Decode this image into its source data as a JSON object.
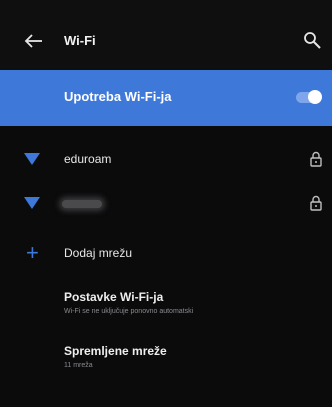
{
  "header": {
    "title": "Wi-Fi",
    "back_icon": "arrow-left-icon",
    "search_icon": "search-icon"
  },
  "wifi_toggle": {
    "label": "Upotreba Wi-Fi-ja",
    "enabled": true
  },
  "networks": [
    {
      "name": "eduroam",
      "secured": true,
      "signal": "full",
      "name_obscured": false
    },
    {
      "name": "",
      "secured": true,
      "signal": "full",
      "name_obscured": true
    }
  ],
  "add_network": {
    "label": "Dodaj mrežu",
    "icon": "plus-icon"
  },
  "settings": {
    "title": "Postavke Wi-Fi-ja",
    "subtitle": "Wi-Fi se ne uključuje ponovno automatski"
  },
  "saved": {
    "title": "Spremljene mreže",
    "subtitle": "11 mreža"
  },
  "colors": {
    "accent": "#3e78d8",
    "background": "#0b0b0c",
    "text_primary": "#ffffff",
    "text_secondary": "#8a8a8e"
  }
}
